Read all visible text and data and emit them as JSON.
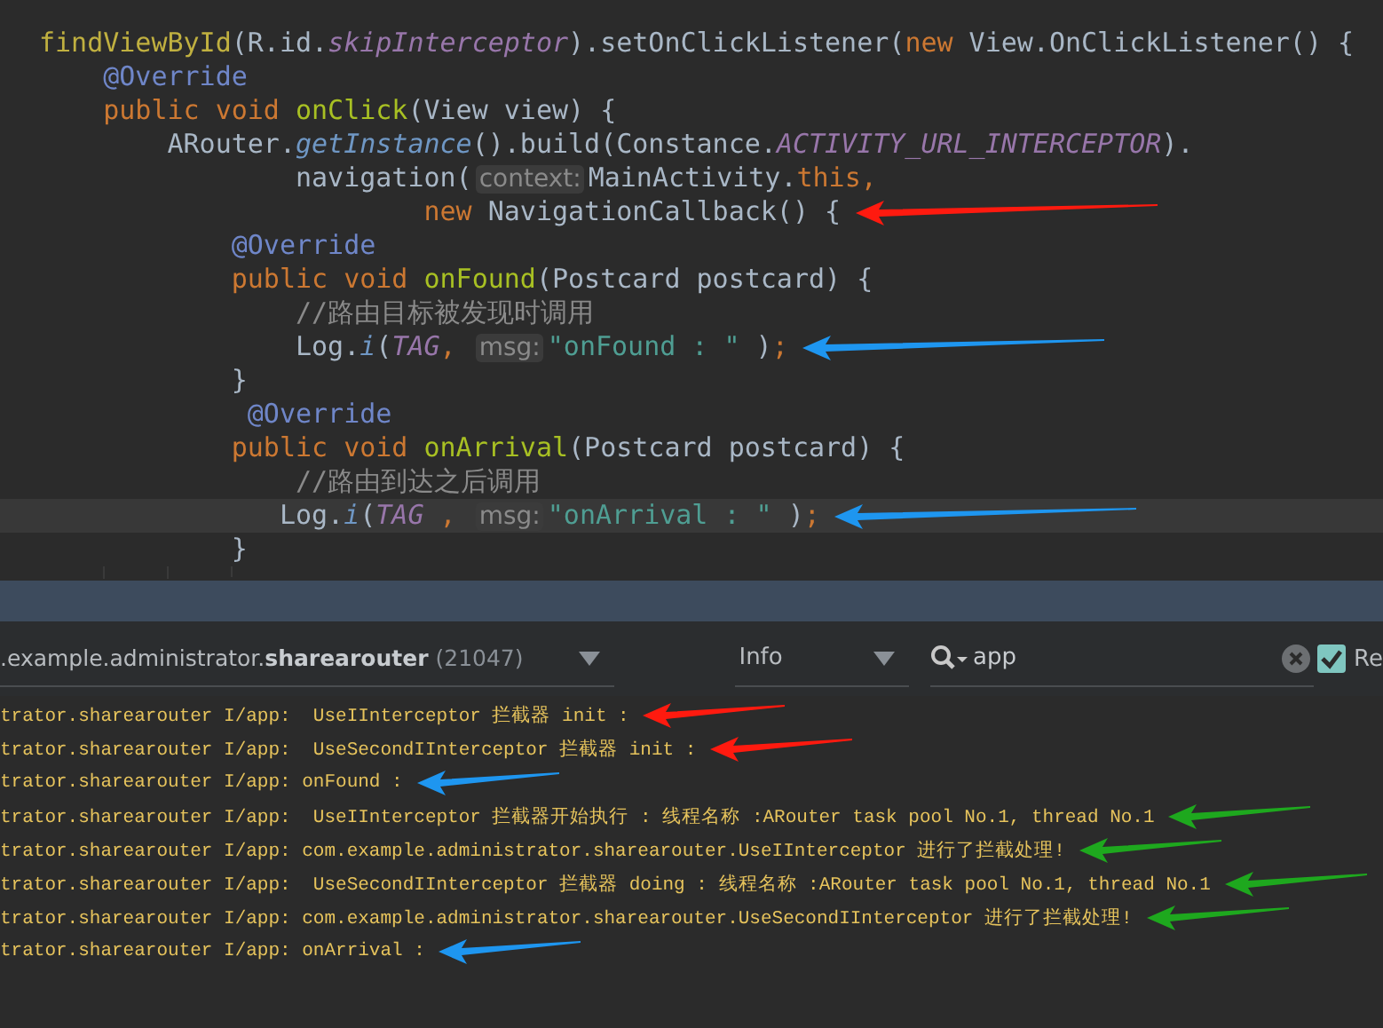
{
  "editor": {
    "lines": [
      {
        "current": false,
        "tokens": [
          {
            "t": "findViewById",
            "kind": "call"
          },
          {
            "t": "(R.id.",
            "kind": "plain"
          },
          {
            "t": "skipInterceptor",
            "kind": "field"
          },
          {
            "t": ").setOnClickListener(",
            "kind": "plain"
          },
          {
            "t": "new",
            "kind": "kw"
          },
          {
            "t": " View.OnClickListener() {",
            "kind": "plain"
          }
        ]
      },
      {
        "current": false,
        "tokens": [
          {
            "t": "    @Override",
            "kind": "ann"
          }
        ]
      },
      {
        "current": false,
        "tokens": [
          {
            "t": "    public void ",
            "kind": "kw"
          },
          {
            "t": "onClick",
            "kind": "fn"
          },
          {
            "t": "(View view) {",
            "kind": "plain"
          }
        ]
      },
      {
        "current": false,
        "tokens": [
          {
            "t": "        ARouter.",
            "kind": "plain"
          },
          {
            "t": "getInstance",
            "kind": "static"
          },
          {
            "t": "().build(Constance.",
            "kind": "plain"
          },
          {
            "t": "ACTIVITY_URL_INTERCEPTOR",
            "kind": "field"
          },
          {
            "t": ").",
            "kind": "plain"
          }
        ]
      },
      {
        "current": false,
        "tokens": [
          {
            "t": "                navigation(",
            "kind": "plain"
          },
          {
            "t": "context:",
            "kind": "hint"
          },
          {
            "t": "MainActivity.",
            "kind": "plain"
          },
          {
            "t": "this",
            "kind": "kw"
          },
          {
            "t": ",",
            "kind": "punct"
          }
        ]
      },
      {
        "current": false,
        "arrow": {
          "color": "#ff1a0f"
        },
        "tokens": [
          {
            "t": "                        new ",
            "kind": "kw"
          },
          {
            "t": "NavigationCallback() {",
            "kind": "plain"
          }
        ]
      },
      {
        "current": false,
        "tokens": [
          {
            "t": "            @Override",
            "kind": "ann"
          }
        ]
      },
      {
        "current": false,
        "tokens": [
          {
            "t": "            public void ",
            "kind": "kw"
          },
          {
            "t": "onFound",
            "kind": "fn"
          },
          {
            "t": "(Postcard postcard) {",
            "kind": "plain"
          }
        ]
      },
      {
        "current": false,
        "tokens": [
          {
            "t": "                //路由目标被发现时调用",
            "kind": "comment"
          }
        ]
      },
      {
        "current": false,
        "arrow": {
          "color": "#1e96f0"
        },
        "tokens": [
          {
            "t": "                Log.",
            "kind": "plain"
          },
          {
            "t": "i",
            "kind": "static"
          },
          {
            "t": "(",
            "kind": "plain"
          },
          {
            "t": "TAG",
            "kind": "field"
          },
          {
            "t": ", ",
            "kind": "punct"
          },
          {
            "t": "msg:",
            "kind": "hint"
          },
          {
            "t": "\"onFound : \"",
            "kind": "str"
          },
          {
            "t": " )",
            "kind": "plain"
          },
          {
            "t": ";",
            "kind": "punct"
          }
        ]
      },
      {
        "current": false,
        "tokens": [
          {
            "t": "            }",
            "kind": "plain"
          }
        ]
      },
      {
        "current": false,
        "tokens": [
          {
            "t": "             @Override",
            "kind": "ann"
          }
        ]
      },
      {
        "current": false,
        "tokens": [
          {
            "t": "            public void ",
            "kind": "kw"
          },
          {
            "t": "onArrival",
            "kind": "fn"
          },
          {
            "t": "(Postcard postcard) {",
            "kind": "plain"
          }
        ]
      },
      {
        "current": false,
        "tokens": [
          {
            "t": "                //路由到达之后调用",
            "kind": "comment"
          }
        ]
      },
      {
        "current": true,
        "arrow": {
          "color": "#1e96f0"
        },
        "tokens": [
          {
            "t": "               Log.",
            "kind": "plain"
          },
          {
            "t": "i",
            "kind": "static"
          },
          {
            "t": "(",
            "kind": "plain"
          },
          {
            "t": "TAG",
            "kind": "field"
          },
          {
            "t": " , ",
            "kind": "punct"
          },
          {
            "t": "msg:",
            "kind": "hint"
          },
          {
            "t": "\"onArrival : \"",
            "kind": "str"
          },
          {
            "t": " )",
            "kind": "plain"
          },
          {
            "t": ";",
            "kind": "punct"
          }
        ]
      },
      {
        "current": false,
        "tokens": [
          {
            "t": "            }",
            "kind": "plain"
          }
        ]
      }
    ]
  },
  "logcat": {
    "process": {
      "prefix": ".example.administrator.",
      "name": "sharearouter",
      "pid": "(21047)"
    },
    "level": "Info",
    "search": {
      "value": "app"
    },
    "regex": {
      "label": "Re",
      "checked": true
    },
    "lines": [
      {
        "text": "trator.sharearouter I/app:  UseIInterceptor 拦截器 init :",
        "arrow": {
          "color": "#ff1a0f"
        }
      },
      {
        "text": "trator.sharearouter I/app:  UseSecondIInterceptor 拦截器 init :",
        "arrow": {
          "color": "#ff1a0f"
        }
      },
      {
        "text": "trator.sharearouter I/app: onFound :",
        "arrow": {
          "color": "#1e96f0"
        }
      },
      {
        "text": "trator.sharearouter I/app:  UseIInterceptor 拦截器开始执行 : 线程名称 :ARouter task pool No.1, thread No.1",
        "arrow": {
          "color": "#1ea81e"
        }
      },
      {
        "text": "trator.sharearouter I/app: com.example.administrator.sharearouter.UseIInterceptor 进行了拦截处理!",
        "arrow": {
          "color": "#1ea81e"
        }
      },
      {
        "text": "trator.sharearouter I/app:  UseSecondIInterceptor 拦截器 doing : 线程名称 :ARouter task pool No.1, thread No.1",
        "arrow": {
          "color": "#1ea81e"
        }
      },
      {
        "text": "trator.sharearouter I/app: com.example.administrator.sharearouter.UseSecondIInterceptor 进行了拦截处理!",
        "arrow": {
          "color": "#1ea81e"
        }
      },
      {
        "text": "trator.sharearouter I/app: onArrival :",
        "arrow": {
          "color": "#1e96f0"
        }
      }
    ]
  }
}
